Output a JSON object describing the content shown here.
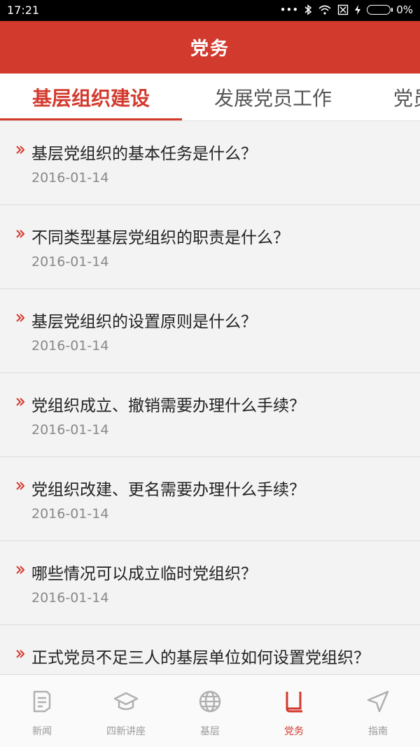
{
  "status_bar": {
    "time": "17:21",
    "battery": "0%"
  },
  "header": {
    "title": "党务"
  },
  "tabs": [
    {
      "label": "基层组织建设",
      "active": true
    },
    {
      "label": "发展党员工作",
      "active": false
    },
    {
      "label": "党员",
      "active": false
    }
  ],
  "list": [
    {
      "title": "基层党组织的基本任务是什么？",
      "date": "2016-01-14"
    },
    {
      "title": "不同类型基层党组织的职责是什么？",
      "date": "2016-01-14"
    },
    {
      "title": "基层党组织的设置原则是什么？",
      "date": "2016-01-14"
    },
    {
      "title": "党组织成立、撤销需要办理什么手续？",
      "date": "2016-01-14"
    },
    {
      "title": "党组织改建、更名需要办理什么手续？",
      "date": "2016-01-14"
    },
    {
      "title": "哪些情况可以成立临时党组织？",
      "date": "2016-01-14"
    },
    {
      "title": "正式党员不足三人的基层单位如何设置党组织？",
      "date": ""
    }
  ],
  "bottom_nav": [
    {
      "label": "新闻",
      "icon": "news-icon",
      "active": false
    },
    {
      "label": "四新讲座",
      "icon": "graduation-cap-icon",
      "active": false
    },
    {
      "label": "基层",
      "icon": "globe-icon",
      "active": false
    },
    {
      "label": "党务",
      "icon": "book-icon",
      "active": true
    },
    {
      "label": "指南",
      "icon": "navigation-arrow-icon",
      "active": false
    }
  ],
  "colors": {
    "brand_red": "#d23a2e",
    "nav_inactive": "#b0b0b0"
  }
}
